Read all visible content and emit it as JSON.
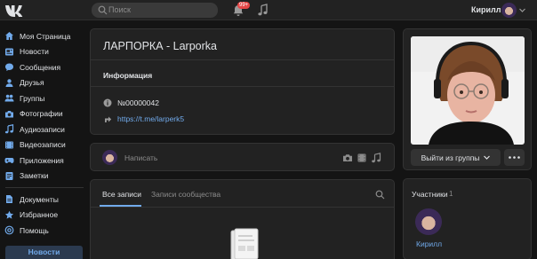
{
  "topbar": {
    "search_placeholder": "Поиск",
    "notifications_count": "99+",
    "user_name": "Кирилл"
  },
  "sidebar": {
    "items": [
      {
        "label": "Моя Страница",
        "icon": "home-icon"
      },
      {
        "label": "Новости",
        "icon": "news-icon"
      },
      {
        "label": "Сообщения",
        "icon": "message-icon"
      },
      {
        "label": "Друзья",
        "icon": "user-icon"
      },
      {
        "label": "Группы",
        "icon": "users-icon"
      },
      {
        "label": "Фотографии",
        "icon": "camera-icon"
      },
      {
        "label": "Аудиозаписи",
        "icon": "music-icon"
      },
      {
        "label": "Видеозаписи",
        "icon": "video-icon"
      },
      {
        "label": "Приложения",
        "icon": "gamepad-icon"
      },
      {
        "label": "Заметки",
        "icon": "note-icon"
      }
    ],
    "secondary": [
      {
        "label": "Документы",
        "icon": "document-icon"
      },
      {
        "label": "Избранное",
        "icon": "star-icon"
      },
      {
        "label": "Помощь",
        "icon": "help-icon"
      }
    ],
    "bottom_tab": "Новости"
  },
  "group": {
    "title": "ЛАРПОРКА - Larporka",
    "info_title": "Информация",
    "id_value": "№00000042",
    "link": "https://t.me/larperk5"
  },
  "post_box": {
    "placeholder": "Написать"
  },
  "wall": {
    "tabs": [
      "Все записи",
      "Записи сообщества"
    ]
  },
  "right": {
    "leave_button": "Выйти из группы",
    "members_title": "Участники",
    "members_count": "1",
    "member_name": "Кирилл"
  },
  "colors": {
    "accent": "#71aaeb",
    "background": "#141414",
    "card": "#222222"
  }
}
